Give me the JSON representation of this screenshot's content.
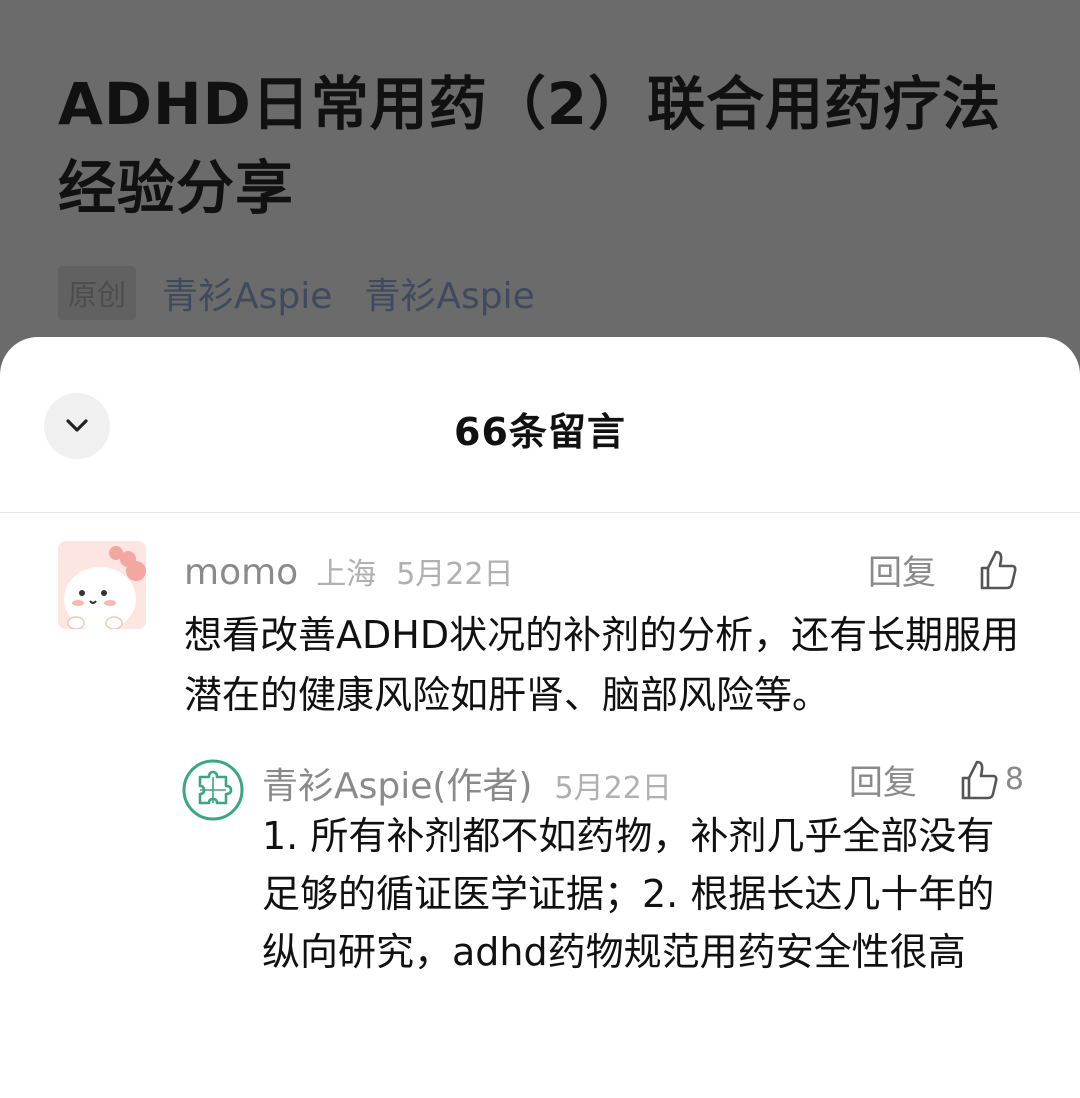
{
  "article": {
    "title": "ADHD日常用药（2）联合用药疗法经验分享",
    "original_tag": "原创",
    "account_name_1": "青衫Aspie",
    "account_name_2": "青衫Aspie"
  },
  "sheet": {
    "title": "66条留言",
    "collapse_icon": "chevron-down-icon"
  },
  "comments": [
    {
      "name": "momo",
      "location": "上海",
      "date": "5月22日",
      "reply_label": "回复",
      "text": "想看改善ADHD状况的补剂的分析，还有长期服用潜在的健康风险如肝肾、脑部风险等。"
    }
  ],
  "replies": [
    {
      "name": "青衫Aspie(作者)",
      "date": "5月22日",
      "reply_label": "回复",
      "likes": "8",
      "text": "1. 所有补剂都不如药物，补剂几乎全部没有足够的循证医学证据；2. 根据长达几十年的纵向研究，adhd药物规范用药安全性很高"
    }
  ],
  "colors": {
    "overlay": "#6b6b6b",
    "sheet_bg": "#ffffff",
    "author_avatar": "#3aa683"
  }
}
